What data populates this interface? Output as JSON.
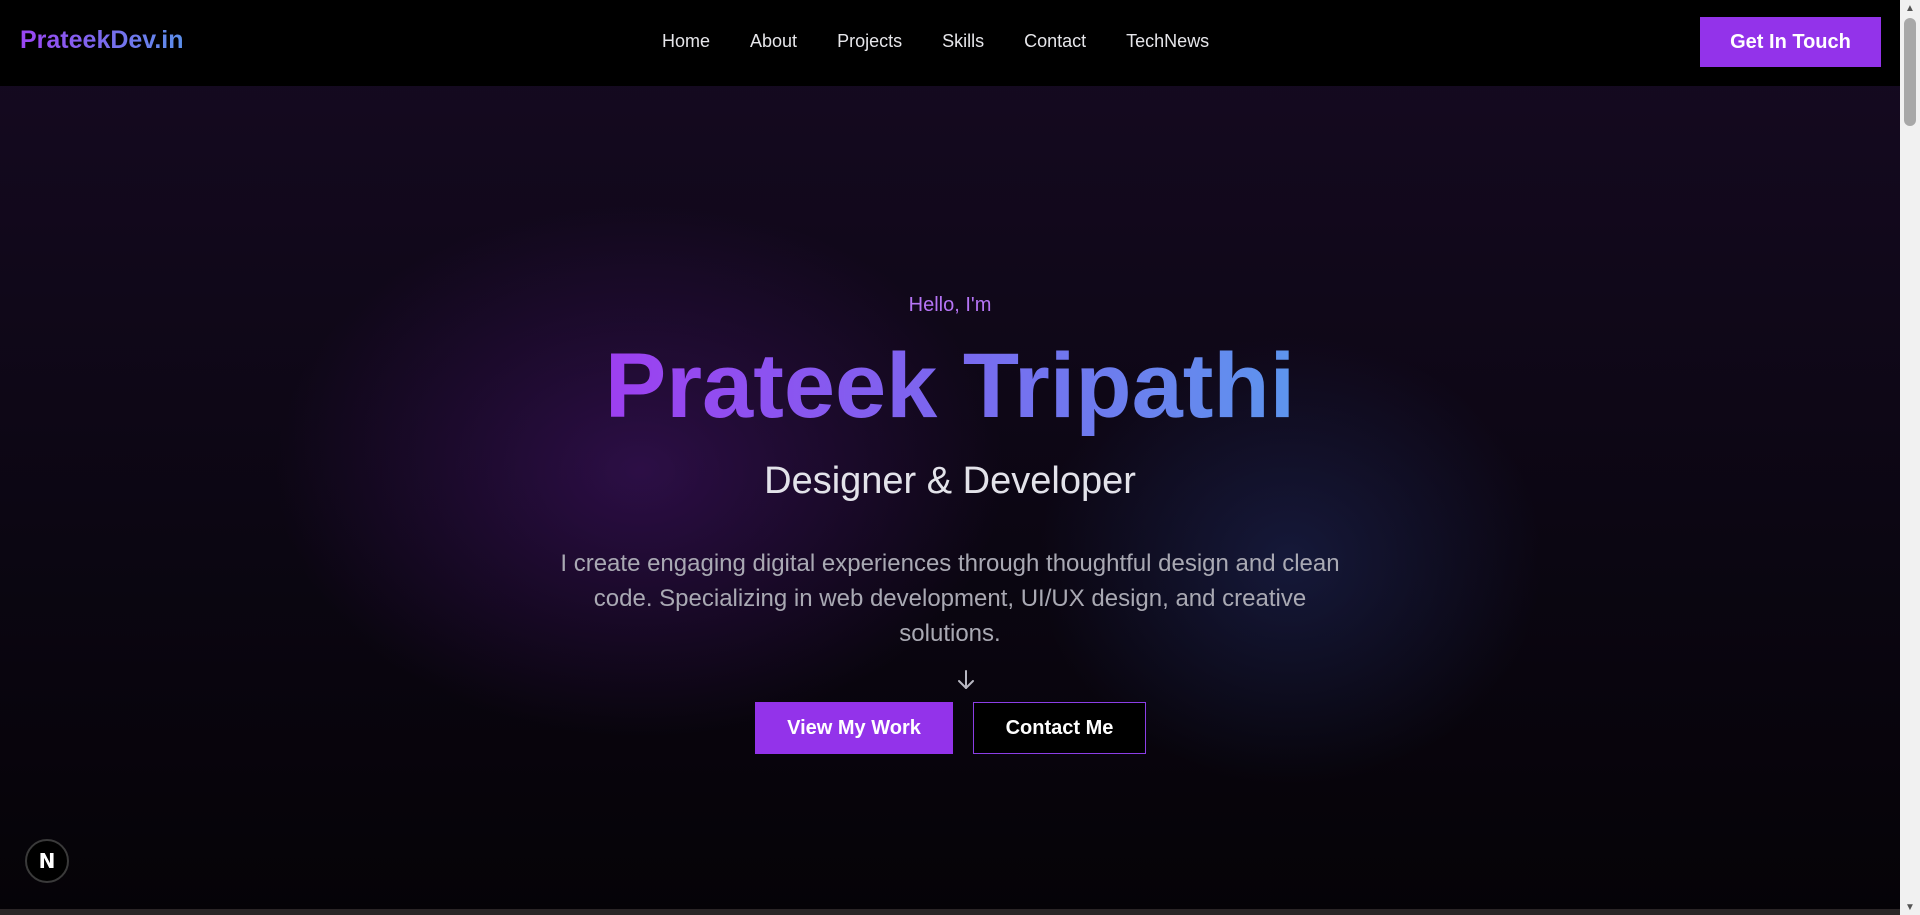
{
  "navbar": {
    "logo": "PrateekDev.in",
    "links": [
      {
        "label": "Home"
      },
      {
        "label": "About"
      },
      {
        "label": "Projects"
      },
      {
        "label": "Skills"
      },
      {
        "label": "Contact"
      },
      {
        "label": "TechNews"
      }
    ],
    "cta_label": "Get In Touch"
  },
  "hero": {
    "greeting": "Hello, I'm",
    "name": "Prateek Tripathi",
    "role": "Designer & Developer",
    "description": "I create engaging digital experiences through thoughtful design and clean code. Specializing in web development, UI/UX design, and creative solutions.",
    "primary_button": "View My Work",
    "secondary_button": "Contact Me",
    "scroll_icon": "arrow-down-icon"
  },
  "badge": {
    "letter": "N",
    "icon": "nextjs-logo-icon"
  },
  "colors": {
    "accent": "#9333ea",
    "greeting": "#b574f5",
    "gradient_start": "#9d3ff0",
    "gradient_end": "#5d95ee",
    "background": "#0b0612"
  }
}
